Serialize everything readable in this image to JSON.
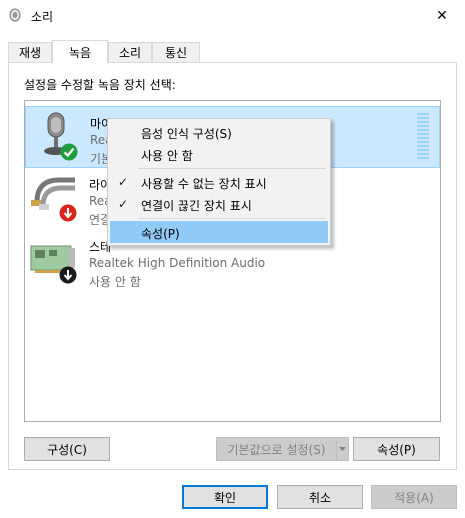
{
  "window": {
    "title": "소리",
    "close_symbol": "✕"
  },
  "tabs": [
    {
      "label": "재생"
    },
    {
      "label": "녹음"
    },
    {
      "label": "소리"
    },
    {
      "label": "통신"
    }
  ],
  "instruction": "설정을 수정할 녹음 장치 선택:",
  "devices": [
    {
      "name": "마이크",
      "driver": "Realtek High Definition Audio",
      "status": "기본 장치",
      "visible_driver": "Rea",
      "visible_status": "기본",
      "visible_name": "마이크",
      "state": "default",
      "selected": true
    },
    {
      "name": "라인 입력",
      "visible_name": "라이",
      "visible_driver": "Rea",
      "visible_status": "연결",
      "state": "unplugged"
    },
    {
      "name": "스테레오 믹스",
      "visible_name": "스테",
      "driver": "Realtek High Definition Audio",
      "status": "사용 안 함",
      "state": "disabled"
    }
  ],
  "context_menu": {
    "items": [
      {
        "label": "음성 인식 구성(S)",
        "checked": false
      },
      {
        "label": "사용 안 함",
        "checked": false
      },
      {
        "label": "사용할 수 없는 장치 표시",
        "checked": true
      },
      {
        "label": "연결이 끊긴 장치 표시",
        "checked": true
      },
      {
        "label": "속성(P)",
        "checked": false,
        "highlighted": true
      }
    ],
    "check_glyph": "✓"
  },
  "buttons": {
    "configure": "구성(C)",
    "set_default": "기본값으로 설정(S)",
    "properties": "속성(P)",
    "ok": "확인",
    "cancel": "취소",
    "apply": "적용(A)"
  },
  "colors": {
    "accent": "#0078d7",
    "selection": "#cce8ff",
    "menu_highlight": "#91c9f7"
  }
}
